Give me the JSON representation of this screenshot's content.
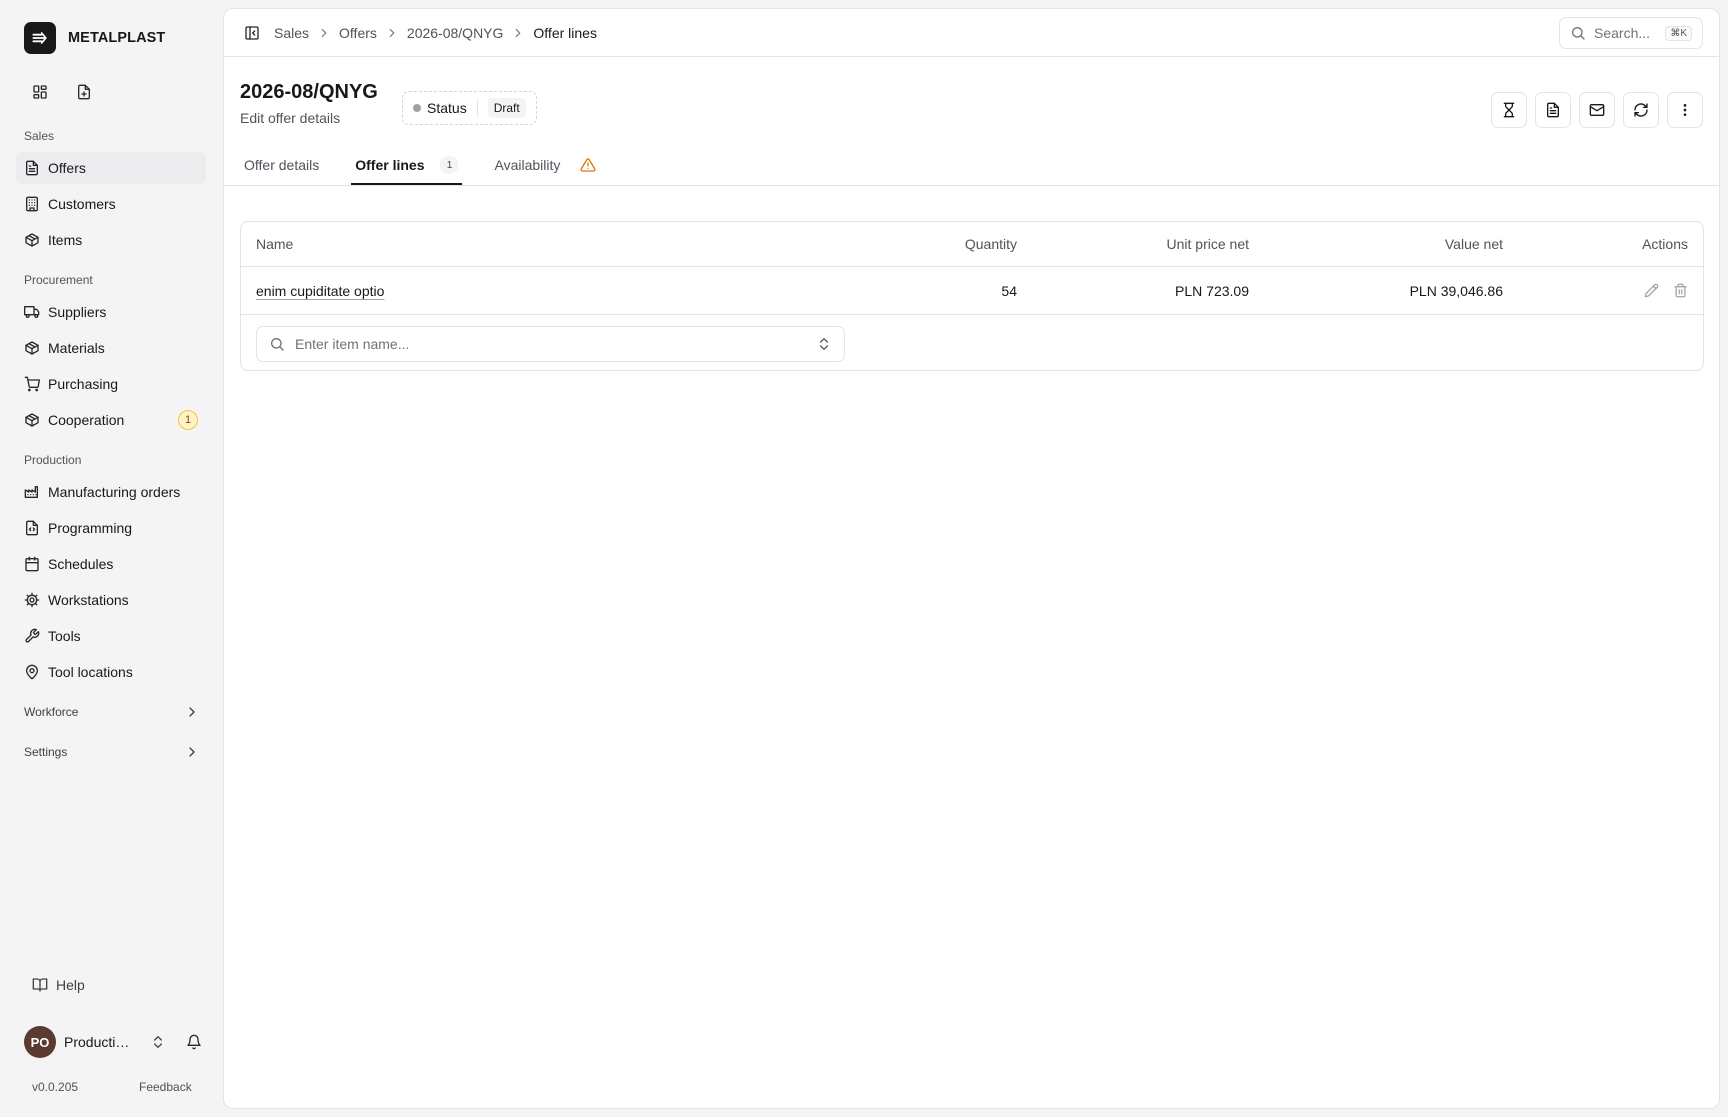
{
  "brand": {
    "name": "METALPLAST"
  },
  "sidebar": {
    "groups": [
      {
        "label": "Sales",
        "items": [
          {
            "label": "Offers",
            "icon": "document-icon",
            "active": true
          },
          {
            "label": "Customers",
            "icon": "building-icon"
          },
          {
            "label": "Items",
            "icon": "package-icon"
          }
        ]
      },
      {
        "label": "Procurement",
        "items": [
          {
            "label": "Suppliers",
            "icon": "truck-icon"
          },
          {
            "label": "Materials",
            "icon": "package-icon"
          },
          {
            "label": "Purchasing",
            "icon": "cart-icon"
          },
          {
            "label": "Cooperation",
            "icon": "package-icon",
            "badge": "1"
          }
        ]
      },
      {
        "label": "Production",
        "items": [
          {
            "label": "Manufacturing orders",
            "icon": "factory-icon"
          },
          {
            "label": "Programming",
            "icon": "file-code-icon"
          },
          {
            "label": "Schedules",
            "icon": "calendar-icon"
          },
          {
            "label": "Workstations",
            "icon": "cog-icon"
          },
          {
            "label": "Tools",
            "icon": "wrench-icon"
          },
          {
            "label": "Tool locations",
            "icon": "map-pin-icon"
          }
        ]
      }
    ],
    "collapsed": [
      {
        "label": "Workforce"
      },
      {
        "label": "Settings"
      }
    ],
    "help_label": "Help",
    "user": {
      "initials": "PO",
      "name": "Production Office"
    },
    "version": "v0.0.205",
    "feedback_label": "Feedback"
  },
  "breadcrumb": [
    "Sales",
    "Offers",
    "2026-08/QNYG",
    "Offer lines"
  ],
  "search": {
    "placeholder": "Search...",
    "shortcut": "⌘K"
  },
  "header": {
    "title": "2026-08/QNYG",
    "subtitle": "Edit offer details",
    "status_label": "Status",
    "status_value": "Draft"
  },
  "tabs": [
    {
      "label": "Offer details"
    },
    {
      "label": "Offer lines",
      "count": "1",
      "active": true
    },
    {
      "label": "Availability",
      "warning": true
    }
  ],
  "table": {
    "columns": {
      "name": "Name",
      "quantity": "Quantity",
      "unit_price": "Unit price net",
      "value": "Value net",
      "actions": "Actions"
    },
    "rows": [
      {
        "name": "enim cupiditate optio",
        "quantity": "54",
        "unit_price": "PLN 723.09",
        "value": "PLN 39,046.86"
      }
    ],
    "add_placeholder": "Enter item name..."
  },
  "colors": {
    "accent": "#18181b",
    "warning": "#d97706",
    "badge_bg": "#fef3c7"
  }
}
